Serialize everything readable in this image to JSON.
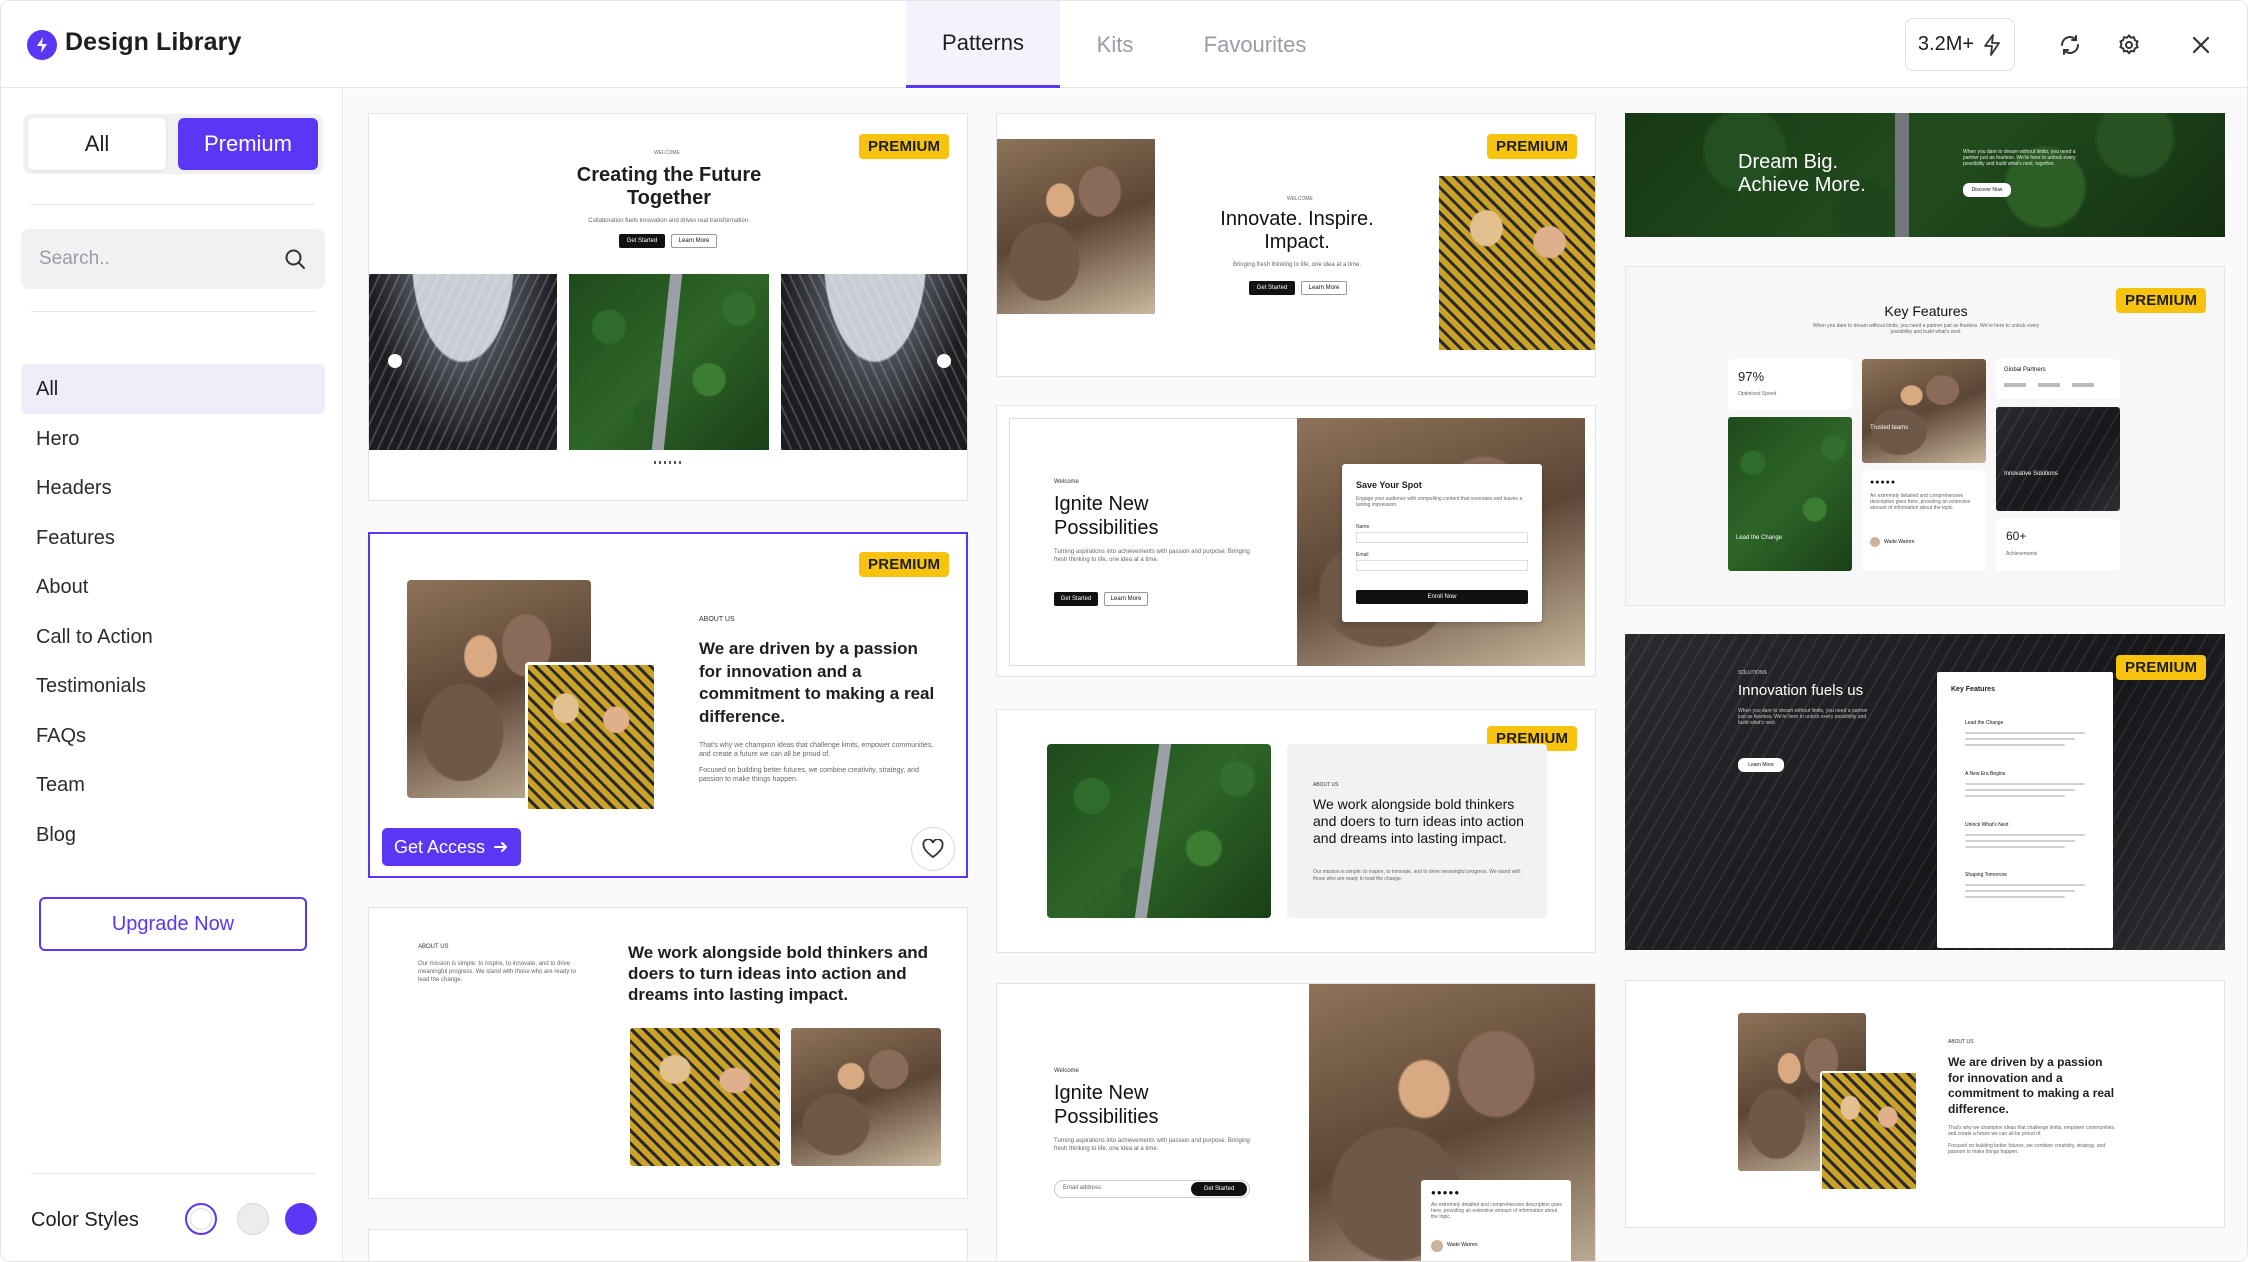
{
  "app": {
    "title": "Design Library"
  },
  "tabs": [
    {
      "label": "Patterns",
      "active": true
    },
    {
      "label": "Kits",
      "active": false
    },
    {
      "label": "Favourites",
      "active": false
    }
  ],
  "header": {
    "count": "3.2M+"
  },
  "sidebar": {
    "filter": {
      "all": "All",
      "premium": "Premium",
      "selected": "Premium"
    },
    "search_placeholder": "Search..",
    "categories": [
      "All",
      "Hero",
      "Headers",
      "Features",
      "About",
      "Call to Action",
      "Testimonials",
      "FAQs",
      "Team",
      "Blog"
    ],
    "active_category": "All",
    "upgrade_label": "Upgrade Now",
    "color_styles_label": "Color Styles",
    "swatches": [
      "#ffffff",
      "#e6e6ea",
      "#5b36f5"
    ]
  },
  "colors": {
    "accent": "#5b36f5",
    "premium_badge": "#f7c30f"
  },
  "cards": {
    "c1": {
      "badge": "PREMIUM",
      "eyebrow": "WELCOME",
      "title": "Creating the Future Together",
      "sub": "Collaboration fuels innovation and drives real transformation.",
      "btn1": "Get Started",
      "btn2": "Learn More"
    },
    "c2": {
      "badge": "PREMIUM",
      "eyebrow": "ABOUT US",
      "title": "We are driven by a passion for innovation and a commitment to making a real difference.",
      "p1": "That's why we champion ideas that challenge limits, empower communities, and create a future we can all be proud of.",
      "p2": "Focused on building better futures, we combine creativity, strategy, and passion to make things happen.",
      "get_access": "Get Access"
    },
    "c3": {
      "eyebrow": "ABOUT US",
      "title": "We work alongside bold thinkers and doers to turn ideas into action and dreams into lasting impact.",
      "p": "Our mission is simple: to inspire, to innovate, and to drive meaningful progress. We stand with those who are ready to lead the change."
    },
    "c4": {
      "badge": "PREMIUM",
      "eyebrow": "WELCOME",
      "title": "Innovate. Inspire. Impact.",
      "sub": "Bringing fresh thinking to life, one idea at a time.",
      "btn1": "Get Started",
      "btn2": "Learn More"
    },
    "c5": {
      "eyebrow": "Welcome",
      "title": "Ignite New Possibilities",
      "sub": "Turning aspirations into achievements with passion and purpose. Bringing fresh thinking to life, one idea at a time.",
      "btn1": "Get Started",
      "btn2": "Learn More",
      "form_title": "Save Your Spot",
      "form_sub": "Engage your audience with compelling content that resonates and leaves a lasting impression.",
      "field1": "Name",
      "field2": "Email",
      "submit": "Enroll Now"
    },
    "c6": {
      "badge": "PREMIUM",
      "eyebrow": "ABOUT US",
      "title": "We work alongside bold thinkers and doers to turn ideas into action and dreams into lasting impact.",
      "p": "Our mission is simple: to inspire, to innovate, and to drive meaningful progress. We stand with those who are ready to lead the change."
    },
    "c7": {
      "eyebrow": "Welcome",
      "title": "Ignite New Possibilities",
      "sub": "Turning aspirations into achievements with passion and purpose. Bringing fresh thinking to life, one idea at a time.",
      "input": "Email address",
      "btn": "Get Started",
      "quote": "An extremely detailed and comprehensive description goes here, providing an extensive amount of information about the topic.",
      "name": "Wade Warren"
    },
    "c8": {
      "title": "Dream Big. Achieve More.",
      "p": "When you dare to dream without limits, you need a partner just as fearless. We're here to unlock every possibility and build what's next, together.",
      "btn": "Discover Now"
    },
    "c9": {
      "badge": "PREMIUM",
      "title": "Key Features",
      "sub": "When you dare to dream without limits, you need a partner just as fearless. We're here to unlock every possibility and build what's next.",
      "stat1": "97%",
      "stat1_label": "Optimised Speed",
      "partners": "Global Partners",
      "trusted": "Trusted teams",
      "lead": "Lead the Change",
      "innovative": "Innovative Solutions",
      "stat2": "60+",
      "stat2_label": "Achievements",
      "quote": "An extremely detailed and comprehensive description goes here, providing an extensive amount of information about the topic.",
      "name": "Wade Warren"
    },
    "c10": {
      "badge": "PREMIUM",
      "eyebrow": "SOLUTIONS",
      "title": "Innovation fuels us",
      "p": "When you dare to dream without limits, you need a partner just as fearless. We're here to unlock every possibility and build what's next.",
      "btn": "Learn More",
      "panel_title": "Key Features",
      "items": [
        "Lead the Change",
        "A New Era Begins",
        "Unlock What's Next",
        "Shaping Tomorrow"
      ]
    },
    "c11": {
      "eyebrow": "ABOUT US",
      "title": "We are driven by a passion for innovation and a commitment to making a real difference.",
      "p1": "That's why we champion ideas that challenge limits, empower communities, and create a future we can all be proud of.",
      "p2": "Focused on building better futures, we combine creativity, strategy, and passion to make things happen."
    }
  }
}
